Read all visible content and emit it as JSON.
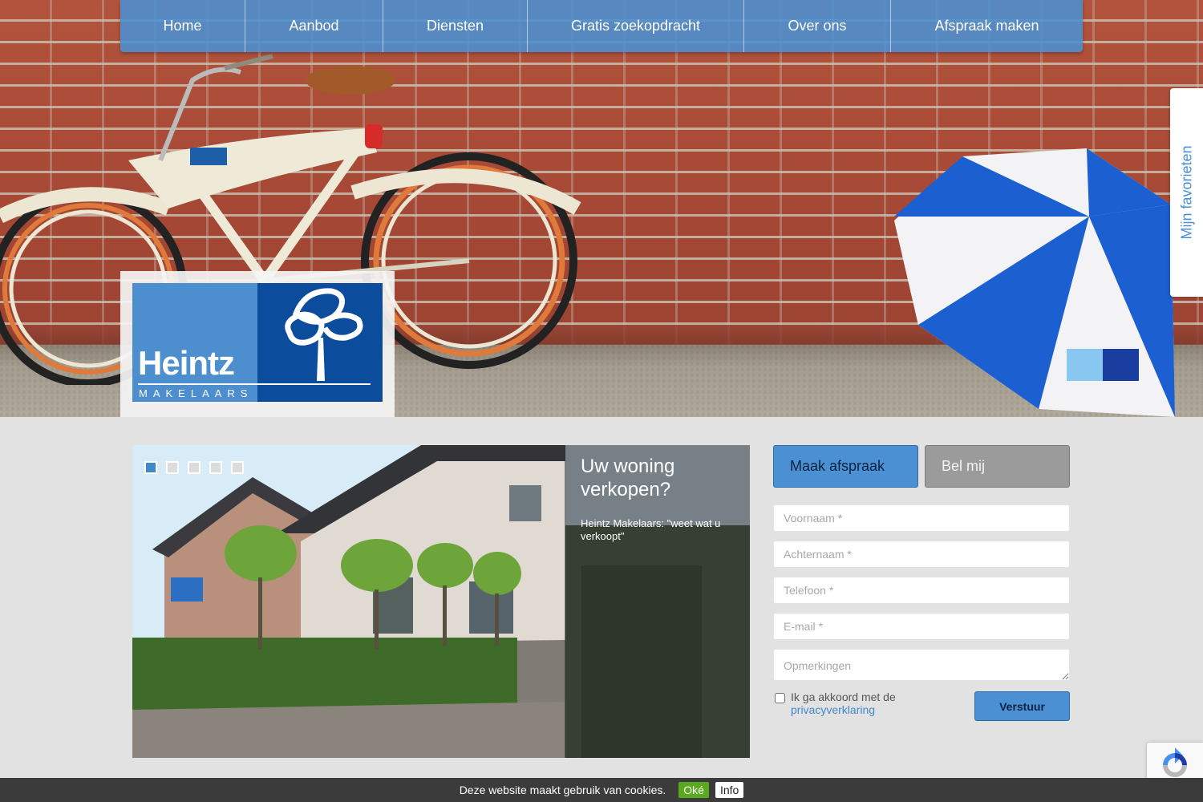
{
  "nav": {
    "items": [
      {
        "label": "Home"
      },
      {
        "label": "Aanbod"
      },
      {
        "label": "Diensten"
      },
      {
        "label": "Gratis zoekopdracht"
      },
      {
        "label": "Over ons"
      },
      {
        "label": "Afspraak maken"
      }
    ]
  },
  "logo": {
    "brand": "Heintz",
    "subtitle": "MAKELAARS",
    "icon": "tree-icon"
  },
  "favorites": {
    "label": "Mijn favorieten"
  },
  "slider": {
    "slide_count": 5,
    "active_index": 0,
    "caption_title": "Uw woning verkopen?",
    "caption_text": "Heintz Makelaars: \"weet wat u verkoopt\""
  },
  "form": {
    "tabs": [
      {
        "label": "Maak afspraak",
        "active": true
      },
      {
        "label": "Bel mij",
        "active": false
      }
    ],
    "fields": {
      "firstname_placeholder": "Voornaam *",
      "lastname_placeholder": "Achternaam *",
      "phone_placeholder": "Telefoon *",
      "email_placeholder": "E-mail *",
      "remarks_placeholder": "Opmerkingen"
    },
    "consent_text": "Ik ga akkoord met de",
    "consent_link": "privacyverklaring",
    "consent_checked": false,
    "submit_label": "Verstuur"
  },
  "recaptcha": {
    "icon": "recaptcha-icon"
  },
  "cookie_bar": {
    "text": "Deze website maakt gebruik van cookies.",
    "ok_label": "Oké",
    "info_label": "Info"
  },
  "colors": {
    "brand_blue": "#4a90d2",
    "brand_dark_blue": "#0b4c9c",
    "cookie_ok_green": "#5aa81e",
    "page_background": "#e2e2e2"
  }
}
